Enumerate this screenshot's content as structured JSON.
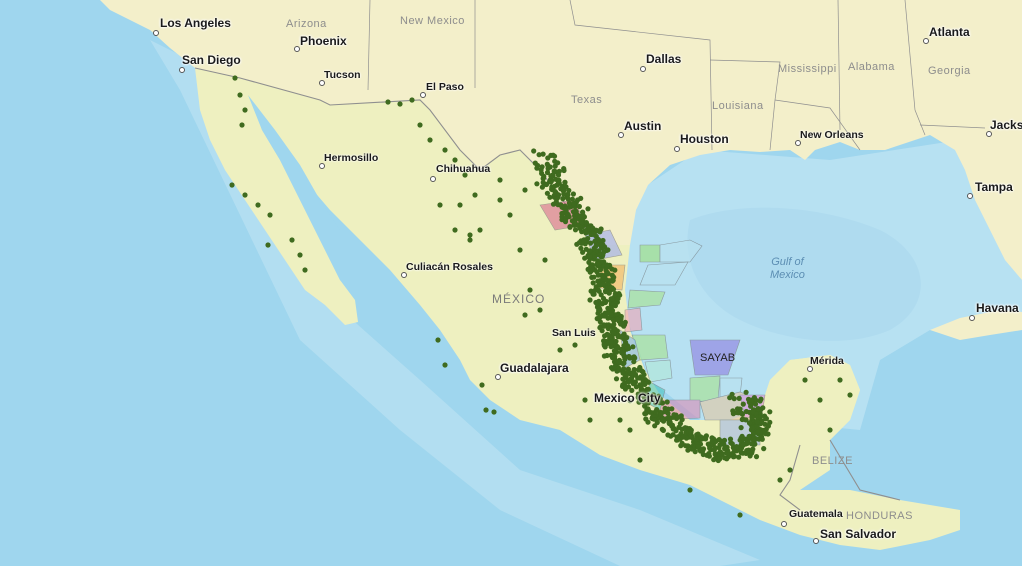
{
  "cities": [
    {
      "name": "Los Angeles",
      "size": "lg"
    },
    {
      "name": "San Diego",
      "size": "lg"
    },
    {
      "name": "Phoenix",
      "size": "lg"
    },
    {
      "name": "Tucson",
      "size": "sm"
    },
    {
      "name": "El Paso",
      "size": "sm"
    },
    {
      "name": "Dallas",
      "size": "lg"
    },
    {
      "name": "Austin",
      "size": "lg"
    },
    {
      "name": "Houston",
      "size": "lg"
    },
    {
      "name": "New Orleans",
      "size": "sm"
    },
    {
      "name": "Atlanta",
      "size": "lg"
    },
    {
      "name": "Jacks",
      "size": "lg"
    },
    {
      "name": "Tampa",
      "size": "lg"
    },
    {
      "name": "Hermosillo",
      "size": "sm"
    },
    {
      "name": "Chihuahua",
      "size": "sm"
    },
    {
      "name": "Culiacán Rosales",
      "size": "sm"
    },
    {
      "name": "San Luis",
      "size": "sm"
    },
    {
      "name": "Guadalajara",
      "size": "lg"
    },
    {
      "name": "Mexico City",
      "size": "lg"
    },
    {
      "name": "Mérida",
      "size": "sm"
    },
    {
      "name": "Havana",
      "size": "lg"
    },
    {
      "name": "Guatemala",
      "size": "sm"
    },
    {
      "name": "San Salvador",
      "size": "lg"
    }
  ],
  "regions": [
    {
      "name": "Arizona"
    },
    {
      "name": "New Mexico"
    },
    {
      "name": "Texas"
    },
    {
      "name": "Louisiana"
    },
    {
      "name": "Mississippi"
    },
    {
      "name": "Alabama"
    },
    {
      "name": "Georgia"
    },
    {
      "name": "MÉXICO"
    },
    {
      "name": "BELIZE"
    },
    {
      "name": "HONDURAS"
    }
  ],
  "water": {
    "gulf_line1": "Gulf of",
    "gulf_line2": "Mexico"
  },
  "block_label": "SAYAB",
  "colors": {
    "ocean": "#9fd6ee",
    "shelf": "#c6e9f6",
    "land": "#f2efc8",
    "mexico_land": "#eef0c0",
    "border": "#8f8f8f",
    "dots": "#3f6b1f"
  }
}
